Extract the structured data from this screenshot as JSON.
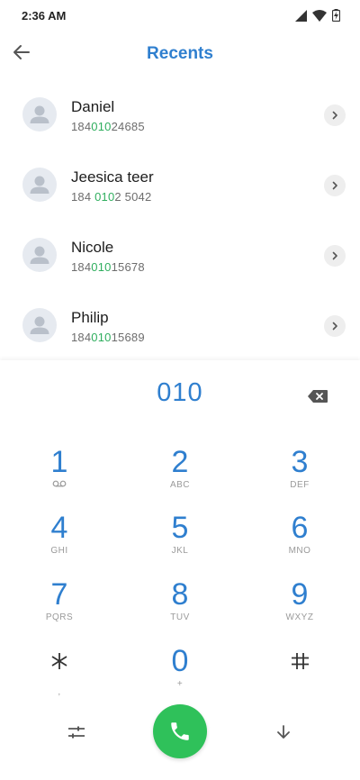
{
  "status_bar": {
    "time": "2:36 AM",
    "icons": [
      "signal-icon",
      "wifi-icon",
      "battery-charging-icon"
    ]
  },
  "app_bar": {
    "title": "Recents",
    "back_icon": "arrow-left-icon"
  },
  "contacts": [
    {
      "name": "Daniel",
      "number_prefix": "184",
      "number_match": "010",
      "number_suffix": "24685"
    },
    {
      "name": "Jeesica teer",
      "number_prefix": "184 ",
      "number_match": "010",
      "number_suffix": "2 5042"
    },
    {
      "name": "Nicole",
      "number_prefix": "184",
      "number_match": "010",
      "number_suffix": "15678"
    },
    {
      "name": "Philip",
      "number_prefix": "184",
      "number_match": "010",
      "number_suffix": "15689"
    }
  ],
  "dialpad": {
    "entered_number": "010",
    "keys": [
      {
        "digit": "1",
        "letters": ""
      },
      {
        "digit": "2",
        "letters": "ABC"
      },
      {
        "digit": "3",
        "letters": "DEF"
      },
      {
        "digit": "4",
        "letters": "GHI"
      },
      {
        "digit": "5",
        "letters": "JKL"
      },
      {
        "digit": "6",
        "letters": "MNO"
      },
      {
        "digit": "7",
        "letters": "PQRS"
      },
      {
        "digit": "8",
        "letters": "TUV"
      },
      {
        "digit": "9",
        "letters": "WXYZ"
      },
      {
        "digit": "*",
        "letters": ","
      },
      {
        "digit": "0",
        "letters": "+"
      },
      {
        "digit": "#",
        "letters": ""
      }
    ]
  },
  "colors": {
    "accent": "#2f7fcf",
    "match_highlight": "#2fae5e",
    "call_button": "#2fc15a"
  }
}
